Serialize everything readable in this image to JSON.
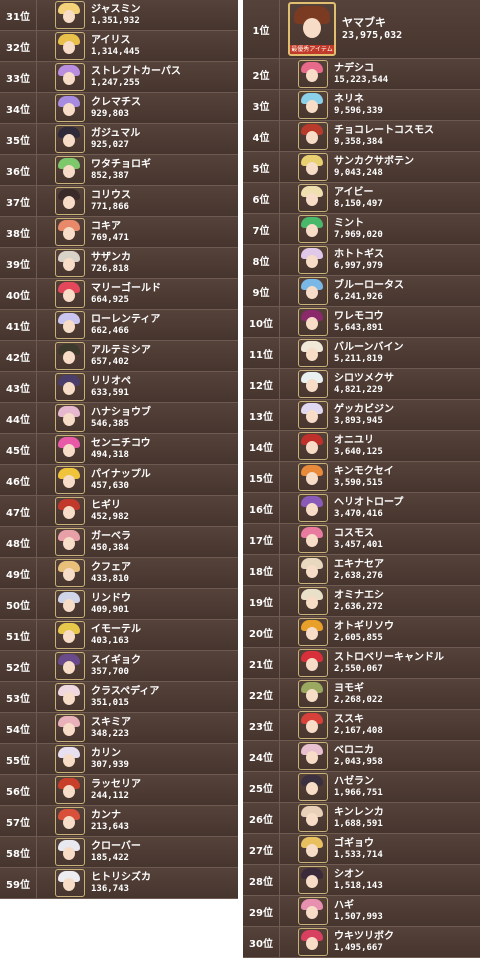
{
  "top": {
    "rank": "1位",
    "name": "ヤマブキ",
    "votes": "23,975,032",
    "banner": "最優秀アイテム追加",
    "hair": "#7a3b22"
  },
  "left": [
    {
      "rank": "31位",
      "name": "ジャスミン",
      "votes": "1,351,932",
      "hair": "#f3d27a"
    },
    {
      "rank": "32位",
      "name": "アイリス",
      "votes": "1,314,445",
      "hair": "#e9c04a"
    },
    {
      "rank": "33位",
      "name": "ストレプトカーパス",
      "votes": "1,247,255",
      "hair": "#b98ee0"
    },
    {
      "rank": "34位",
      "name": "クレマチス",
      "votes": "929,803",
      "hair": "#a78be0"
    },
    {
      "rank": "35位",
      "name": "ガジュマル",
      "votes": "925,027",
      "hair": "#2e2a3a"
    },
    {
      "rank": "36位",
      "name": "ワタチョロギ",
      "votes": "852,387",
      "hair": "#7cc86a"
    },
    {
      "rank": "37位",
      "name": "コリウス",
      "votes": "771,866",
      "hair": "#3a2a2a"
    },
    {
      "rank": "38位",
      "name": "コキア",
      "votes": "769,471",
      "hair": "#e88a6a"
    },
    {
      "rank": "39位",
      "name": "サザンカ",
      "votes": "726,818",
      "hair": "#d9d2c8"
    },
    {
      "rank": "40位",
      "name": "マリーゴールド",
      "votes": "664,925",
      "hair": "#e2485a"
    },
    {
      "rank": "41位",
      "name": "ローレンティア",
      "votes": "662,466",
      "hair": "#c9c4f0"
    },
    {
      "rank": "42位",
      "name": "アルテミシア",
      "votes": "657,402",
      "hair": "#3b3a2c"
    },
    {
      "rank": "43位",
      "name": "リリオペ",
      "votes": "633,591",
      "hair": "#4a3f6a"
    },
    {
      "rank": "44位",
      "name": "ハナショウブ",
      "votes": "546,385",
      "hair": "#e6b8d0"
    },
    {
      "rank": "45位",
      "name": "センニチコウ",
      "votes": "494,318",
      "hair": "#e85aa8"
    },
    {
      "rank": "46位",
      "name": "パイナップル",
      "votes": "457,630",
      "hair": "#f0c43a"
    },
    {
      "rank": "47位",
      "name": "ヒギリ",
      "votes": "452,982",
      "hair": "#c0392b"
    },
    {
      "rank": "48位",
      "name": "ガーベラ",
      "votes": "450,384",
      "hair": "#e8a0a8"
    },
    {
      "rank": "49位",
      "name": "クフェア",
      "votes": "433,810",
      "hair": "#e8c07a"
    },
    {
      "rank": "50位",
      "name": "リンドウ",
      "votes": "409,901",
      "hair": "#d0d4e8"
    },
    {
      "rank": "51位",
      "name": "イモーテル",
      "votes": "403,163",
      "hair": "#e8c84a"
    },
    {
      "rank": "52位",
      "name": "スイギョク",
      "votes": "357,700",
      "hair": "#6a4a8a"
    },
    {
      "rank": "53位",
      "name": "クラスペディア",
      "votes": "351,015",
      "hair": "#f0d8e0"
    },
    {
      "rank": "54位",
      "name": "スキミア",
      "votes": "348,223",
      "hair": "#e8b0b8"
    },
    {
      "rank": "55位",
      "name": "カリン",
      "votes": "307,939",
      "hair": "#e8e0f0"
    },
    {
      "rank": "56位",
      "name": "ラッセリア",
      "votes": "244,112",
      "hair": "#c8402a"
    },
    {
      "rank": "57位",
      "name": "カンナ",
      "votes": "213,643",
      "hair": "#d8503a"
    },
    {
      "rank": "58位",
      "name": "クローバー",
      "votes": "185,422",
      "hair": "#e8e8f0"
    },
    {
      "rank": "59位",
      "name": "ヒトリシズカ",
      "votes": "136,743",
      "hair": "#ececf2"
    }
  ],
  "right": [
    {
      "rank": "2位",
      "name": "ナデシコ",
      "votes": "15,223,544",
      "hair": "#e86a8a"
    },
    {
      "rank": "3位",
      "name": "ネリネ",
      "votes": "9,596,339",
      "hair": "#8ad0e8"
    },
    {
      "rank": "4位",
      "name": "チョコレートコスモス",
      "votes": "9,358,384",
      "hair": "#b83a2a"
    },
    {
      "rank": "5位",
      "name": "サンカクサボテン",
      "votes": "9,043,248",
      "hair": "#e8d070"
    },
    {
      "rank": "6位",
      "name": "アイビー",
      "votes": "8,150,497",
      "hair": "#f0e0b0"
    },
    {
      "rank": "7位",
      "name": "ミント",
      "votes": "7,969,020",
      "hair": "#4ab86a"
    },
    {
      "rank": "8位",
      "name": "ホトトギス",
      "votes": "6,997,979",
      "hair": "#e0c8e8"
    },
    {
      "rank": "9位",
      "name": "ブルーロータス",
      "votes": "6,241,926",
      "hair": "#7ab8e8"
    },
    {
      "rank": "10位",
      "name": "ワレモコウ",
      "votes": "5,643,891",
      "hair": "#8a2a6a"
    },
    {
      "rank": "11位",
      "name": "バルーンバイン",
      "votes": "5,211,819",
      "hair": "#f0e8d8"
    },
    {
      "rank": "12位",
      "name": "シロツメクサ",
      "votes": "4,821,229",
      "hair": "#e8f0f0"
    },
    {
      "rank": "13位",
      "name": "ゲッカビジン",
      "votes": "3,893,945",
      "hair": "#e0d8f0"
    },
    {
      "rank": "14位",
      "name": "オニユリ",
      "votes": "3,640,125",
      "hair": "#c0302a"
    },
    {
      "rank": "15位",
      "name": "キンモクセイ",
      "votes": "3,590,515",
      "hair": "#e88a3a"
    },
    {
      "rank": "16位",
      "name": "ヘリオトロープ",
      "votes": "3,470,416",
      "hair": "#8a5ab8"
    },
    {
      "rank": "17位",
      "name": "コスモス",
      "votes": "3,457,401",
      "hair": "#e87aa0"
    },
    {
      "rank": "18位",
      "name": "エキナセア",
      "votes": "2,638,276",
      "hair": "#e8d8c0"
    },
    {
      "rank": "19位",
      "name": "オミナエシ",
      "votes": "2,636,272",
      "hair": "#e8e0c8"
    },
    {
      "rank": "20位",
      "name": "オトギリソウ",
      "votes": "2,605,855",
      "hair": "#e8a02a"
    },
    {
      "rank": "21位",
      "name": "ストロベリーキャンドル",
      "votes": "2,550,067",
      "hair": "#d8303a"
    },
    {
      "rank": "22位",
      "name": "ヨモギ",
      "votes": "2,268,022",
      "hair": "#9aa860"
    },
    {
      "rank": "23位",
      "name": "ススキ",
      "votes": "2,167,408",
      "hair": "#d8403a"
    },
    {
      "rank": "24位",
      "name": "ベロニカ",
      "votes": "2,043,958",
      "hair": "#e8c0d0"
    },
    {
      "rank": "25位",
      "name": "ハゼラン",
      "votes": "1,966,751",
      "hair": "#3a3040"
    },
    {
      "rank": "26位",
      "name": "キンレンカ",
      "votes": "1,688,591",
      "hair": "#e8d0b8"
    },
    {
      "rank": "27位",
      "name": "ゴギョウ",
      "votes": "1,533,714",
      "hair": "#e8c060"
    },
    {
      "rank": "28位",
      "name": "シオン",
      "votes": "1,518,143",
      "hair": "#3a2a3a"
    },
    {
      "rank": "29位",
      "name": "ハギ",
      "votes": "1,507,993",
      "hair": "#e890b0"
    },
    {
      "rank": "30位",
      "name": "ウキツリボク",
      "votes": "1,495,667",
      "hair": "#d84060"
    }
  ]
}
